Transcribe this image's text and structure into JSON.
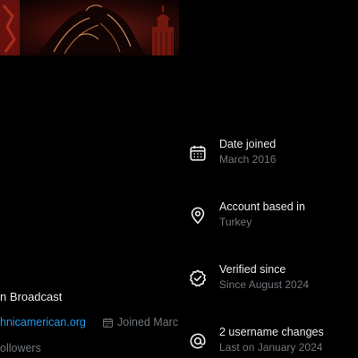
{
  "profile": {
    "display_name_fragment": "n Broadcast",
    "website_fragment": "hnicamerican.org",
    "joined_fragment": "Joined Marc",
    "followers_fragment": "ollowers"
  },
  "about_account": {
    "items": [
      {
        "icon": "calendar-icon",
        "title": "Date joined",
        "subtitle": "March 2016"
      },
      {
        "icon": "location-pin-icon",
        "title": "Account based in",
        "subtitle": "Turkey"
      },
      {
        "icon": "verified-badge-icon",
        "title": "Verified since",
        "subtitle": "Since August 2024"
      },
      {
        "icon": "at-sign-icon",
        "title": "2 username changes",
        "subtitle": "Last on January 2024"
      }
    ]
  },
  "colors": {
    "background": "#000000",
    "primary_text": "#e7e9ea",
    "secondary_text": "#71767b",
    "link": "#1d9bf0"
  }
}
